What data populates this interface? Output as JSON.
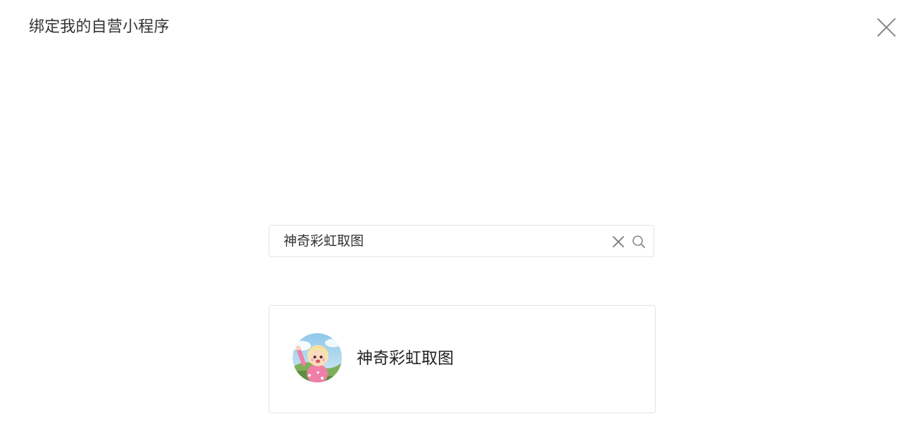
{
  "dialog": {
    "title": "绑定我的自营小程序",
    "close_icon": "close-icon"
  },
  "search": {
    "value": "神奇彩虹取图",
    "clear_icon": "clear-icon",
    "search_icon": "search-icon"
  },
  "results": [
    {
      "name": "神奇彩虹取图",
      "avatar_icon": "mini-program-avatar"
    }
  ],
  "colors": {
    "border": "#e2e2e2",
    "text": "#333333",
    "icon": "#888888"
  }
}
